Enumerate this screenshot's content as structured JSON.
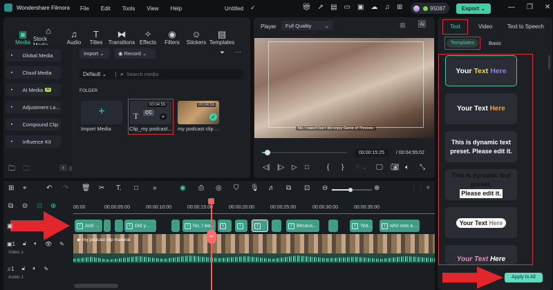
{
  "app": {
    "title": "Wondershare Filmora",
    "menu": [
      "File",
      "Edit",
      "Tools",
      "View",
      "Help"
    ],
    "project": "Untitled",
    "credits": "95087",
    "export": "Export"
  },
  "media_tabs": [
    "Media",
    "Stock Media",
    "Audio",
    "Titles",
    "Transitions",
    "Effects",
    "Filters",
    "Stickers",
    "Templates"
  ],
  "sidebar": [
    "Global Media",
    "Cloud Media",
    "AI Media",
    "Adjustment La...",
    "Compound Clip",
    "Influence Kit"
  ],
  "ai_badge": "AI",
  "toolbar": {
    "import": "Import",
    "record": "Record",
    "sort": "Default",
    "search_placeholder": "Search media"
  },
  "folder_label": "FOLDER",
  "media_items": [
    {
      "label": "Import Media"
    },
    {
      "label": "Clip_my podcast...",
      "duration": "00:04:55",
      "badge": "CC"
    },
    {
      "label": "my podcast clip ...",
      "duration": "00:04:55"
    }
  ],
  "player": {
    "label": "Player",
    "quality": "Full Quality",
    "subtitle": "No, I wasn't but I did enjoy Game of Thrones.",
    "current": "00:00:15:25",
    "total": "/ 00:04:55:02",
    "progress": 0.05
  },
  "right_panel": {
    "tabs": [
      "Text",
      "Video",
      "Text to Speech"
    ],
    "subtabs": [
      "Templates",
      "Basic"
    ],
    "templates": [
      "Your Text Here",
      "Your Text Here",
      "This is dynamic text preset. Please edit it.",
      "This is dynamic text preset.",
      "Please edit it.",
      "Your Text Here",
      "Your Text Here"
    ],
    "apply_all": "Apply to All"
  },
  "timeline": {
    "ticks": [
      "00:00",
      "00:00:05:00",
      "00:00:10:00",
      "00:00:15:00",
      "00:00:20:00",
      "00:00:25:00",
      "00:00:30:00",
      "00:00:35:00"
    ],
    "clips": [
      "And ...",
      "Did y...",
      "No, I wa...",
      "Becaus...",
      "Yea...",
      "who was a..."
    ],
    "video_clip": "my podcast clip material",
    "video_track": "Video 1",
    "audio_track": "Audio 1"
  },
  "colors": {
    "accent": "#3ecfa8",
    "highlight": "#d8323a",
    "clip": "#3e9e86"
  }
}
